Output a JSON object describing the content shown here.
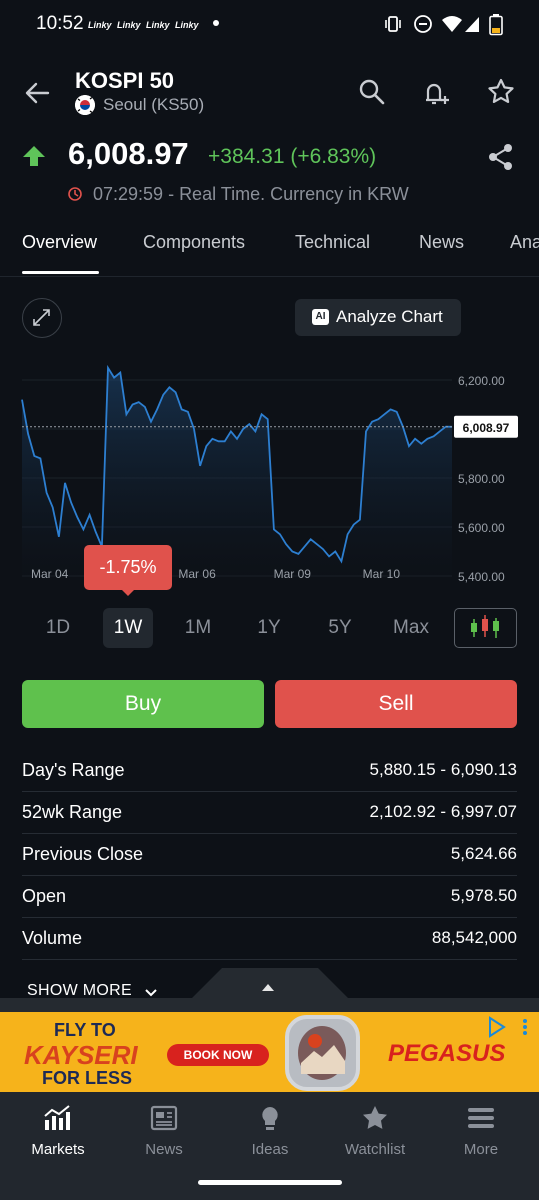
{
  "status_bar": {
    "time": "10:52",
    "notifications": [
      "Linky",
      "Linky",
      "Linky",
      "Linky"
    ]
  },
  "header": {
    "title": "KOSPI 50",
    "exchange": "Seoul (KS50)",
    "flag_icon": "south-korea-flag-icon"
  },
  "quote": {
    "price": "6,008.97",
    "change": "+384.31 (+6.83%)",
    "direction": "up",
    "timestamp": "07:29:59 - Real Time. Currency in KRW",
    "up_color": "#5fc45a"
  },
  "tabs": [
    {
      "label": "Overview",
      "active": true
    },
    {
      "label": "Components",
      "active": false
    },
    {
      "label": "Technical",
      "active": false
    },
    {
      "label": "News",
      "active": false
    },
    {
      "label": "Ana",
      "active": false
    }
  ],
  "chart_controls": {
    "ai_badge": "AI",
    "analyze_label": "Analyze Chart"
  },
  "chart_data": {
    "type": "area",
    "title": "",
    "xlabel": "",
    "ylabel": "",
    "ylim": [
      5400,
      6300
    ],
    "y_ticks": [
      "6,200.00",
      "5,800.00",
      "5,600.00",
      "5,400.00"
    ],
    "x_ticks": [
      "Mar 04",
      "Mar 06",
      "Mar 09",
      "Mar 10"
    ],
    "current_value_label": "6,008.97",
    "current_value": 6008.97,
    "tooltip": "-1.75%",
    "line_color": "#2d7fd1",
    "series": [
      {
        "values": [
          6120,
          5980,
          5890,
          5880,
          5740,
          5680,
          5560,
          5780,
          5700,
          5640,
          5590,
          5650,
          5580,
          5520,
          6250,
          6210,
          6230,
          6060,
          6100,
          6110,
          6090,
          6030,
          6080,
          6140,
          6170,
          6150,
          6080,
          6070,
          6000,
          5850,
          5930,
          5960,
          5950,
          5950,
          5990,
          5960,
          6000,
          6020,
          5990,
          6060,
          6040,
          5590,
          5570,
          5530,
          5500,
          5490,
          5520,
          5550,
          5530,
          5510,
          5480,
          5500,
          5460,
          5570,
          5610,
          5630,
          5990,
          6030,
          6040,
          6060,
          6080,
          6070,
          6010,
          5930,
          5960,
          5940,
          5960,
          5970,
          5990,
          6010,
          6008.97
        ]
      }
    ]
  },
  "ranges": [
    {
      "label": "1D",
      "active": false
    },
    {
      "label": "1W",
      "active": true
    },
    {
      "label": "1M",
      "active": false
    },
    {
      "label": "1Y",
      "active": false
    },
    {
      "label": "5Y",
      "active": false
    },
    {
      "label": "Max",
      "active": false
    }
  ],
  "actions": {
    "buy_label": "Buy",
    "sell_label": "Sell",
    "buy_color": "#5fc14d",
    "sell_color": "#e0524c"
  },
  "stats": [
    {
      "label": "Day's Range",
      "value": "5,880.15 - 6,090.13"
    },
    {
      "label": "52wk Range",
      "value": "2,102.92 - 6,997.07"
    },
    {
      "label": "Previous Close",
      "value": "5,624.66"
    },
    {
      "label": "Open",
      "value": "5,978.50"
    },
    {
      "label": "Volume",
      "value": "88,542,000"
    }
  ],
  "show_more_label": "SHOW MORE",
  "ad": {
    "line1": "FLY TO",
    "line2": "KAYSERI",
    "line3": "FOR LESS",
    "cta": "BOOK NOW",
    "brand": "PEGASUS"
  },
  "bottom_nav": [
    {
      "label": "Markets",
      "icon": "markets-chart-icon",
      "active": true
    },
    {
      "label": "News",
      "icon": "news-icon",
      "active": false
    },
    {
      "label": "Ideas",
      "icon": "lightbulb-icon",
      "active": false
    },
    {
      "label": "Watchlist",
      "icon": "star-icon",
      "active": false
    },
    {
      "label": "More",
      "icon": "menu-icon",
      "active": false
    }
  ]
}
